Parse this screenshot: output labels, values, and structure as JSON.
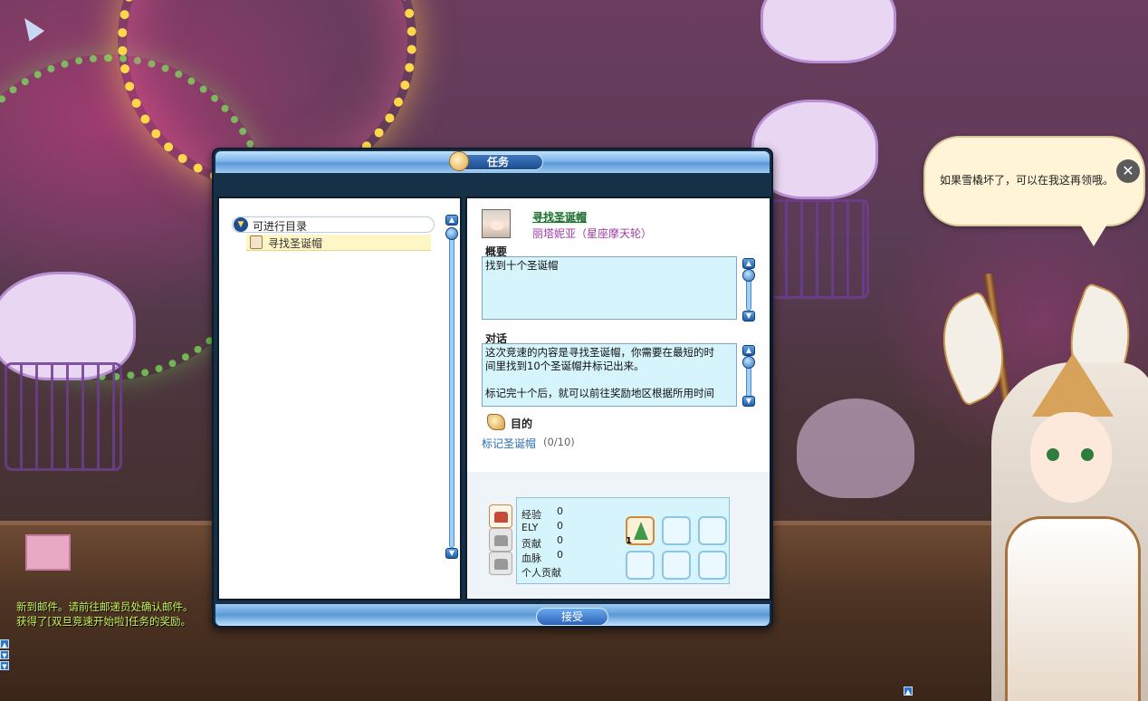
{
  "window": {
    "title": "任务",
    "accept_label": "接受"
  },
  "quest_list": {
    "category_label": "可进行目录",
    "items": [
      {
        "label": "寻找圣诞帽"
      }
    ]
  },
  "detail": {
    "quest_title": "寻找圣诞帽",
    "npc_name": "丽塔妮亚（星座摩天轮）",
    "summary_label": "概要",
    "summary_text": "找到十个圣诞帽",
    "dialog_label": "对话",
    "dialog_lines": [
      "这次竞速的内容是寻找圣诞帽，你需要在最短的时",
      "间里找到10个圣诞帽并标记出来。",
      "",
      "标记完十个后，就可以前往奖励地区根据所用时间"
    ],
    "objective_label": "目的",
    "objective_text": "标记圣诞帽",
    "objective_count": "(0/10)"
  },
  "rewards": {
    "rows": [
      {
        "label": "经验",
        "value": "0"
      },
      {
        "label": "ELY",
        "value": "0"
      },
      {
        "label": "贡献",
        "value": "0"
      },
      {
        "label": "血脉",
        "value": "0"
      },
      {
        "label": "个人贡献",
        "value": ""
      }
    ],
    "item_slots": [
      {
        "icon": "christmas-tree-icon",
        "count": "1"
      },
      {
        "icon": "",
        "count": ""
      },
      {
        "icon": "",
        "count": ""
      },
      {
        "icon": "",
        "count": ""
      },
      {
        "icon": "",
        "count": ""
      },
      {
        "icon": "",
        "count": ""
      }
    ]
  },
  "speech": {
    "text": "如果雪橇坏了，可以在我这再领哦。",
    "close_label": "✕"
  },
  "chat": {
    "lines": [
      "新到邮件。请前往邮递员处确认邮件。",
      "获得了[双旦竞速开始啦]任务的奖励。"
    ]
  },
  "colors": {
    "chat_text": "#c8f35a",
    "panel_bg": "#183045",
    "text_box_bg": "#d6f4fc",
    "npc_name": "#a03aa6",
    "objective_link": "#2b6fb0"
  }
}
